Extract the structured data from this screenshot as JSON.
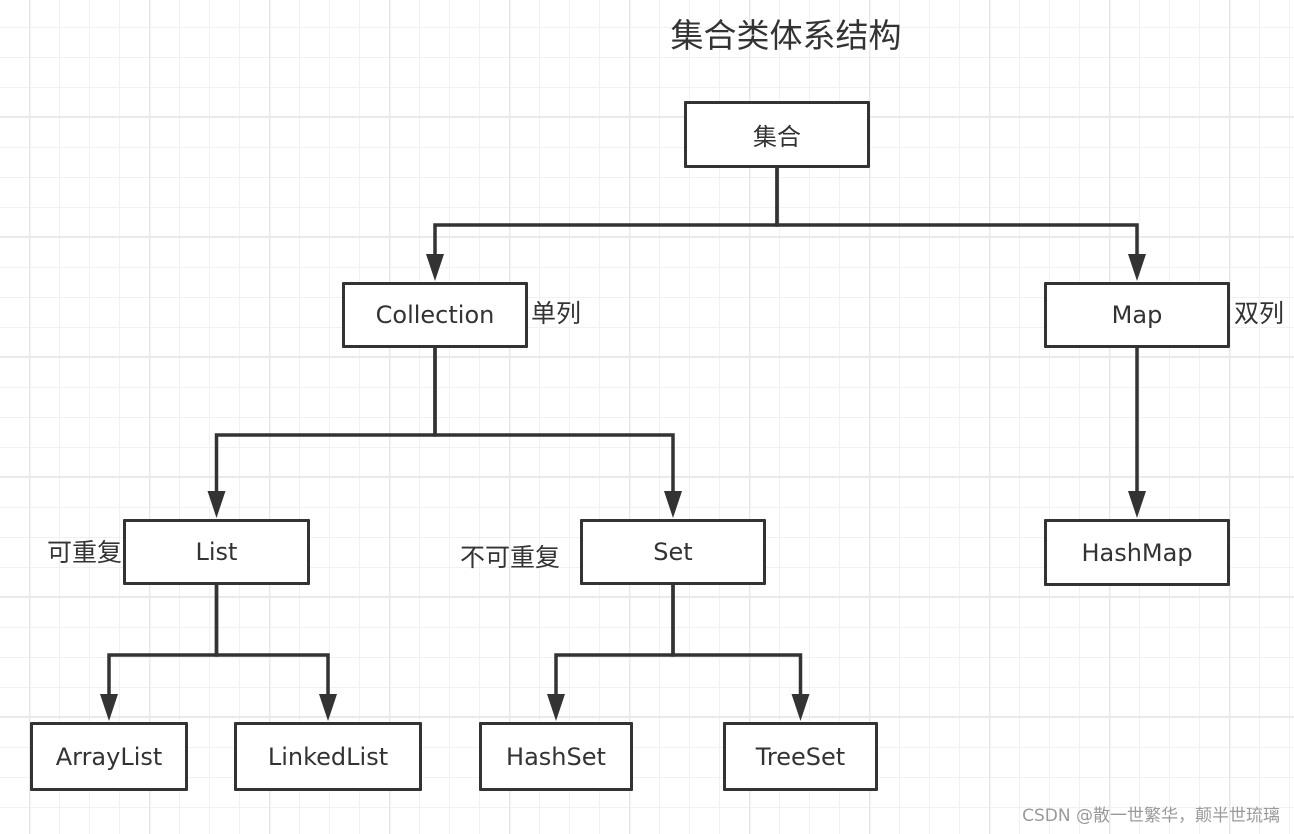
{
  "diagram": {
    "title": "集合类体系结构",
    "colors": {
      "stroke": "#333333",
      "text": "#333333",
      "grid_minor": "#f1f1f1",
      "grid_major": "#e8e8e8",
      "watermark": "#9a9a9a"
    },
    "nodes": {
      "root": "集合",
      "collection": "Collection",
      "map": "Map",
      "list": "List",
      "set": "Set",
      "hashmap": "HashMap",
      "arraylist": "ArrayList",
      "linkedlist": "LinkedList",
      "hashset": "HashSet",
      "treeset": "TreeSet"
    },
    "annotations": {
      "collection": "单列",
      "map": "双列",
      "list": "可重复",
      "set": "不可重复"
    },
    "edges": [
      {
        "from": "root",
        "to": "collection"
      },
      {
        "from": "root",
        "to": "map"
      },
      {
        "from": "collection",
        "to": "list"
      },
      {
        "from": "collection",
        "to": "set"
      },
      {
        "from": "map",
        "to": "hashmap"
      },
      {
        "from": "list",
        "to": "arraylist"
      },
      {
        "from": "list",
        "to": "linkedlist"
      },
      {
        "from": "set",
        "to": "hashset"
      },
      {
        "from": "set",
        "to": "treeset"
      }
    ]
  },
  "watermark": "CSDN @散一世繁华，颠半世琉璃"
}
